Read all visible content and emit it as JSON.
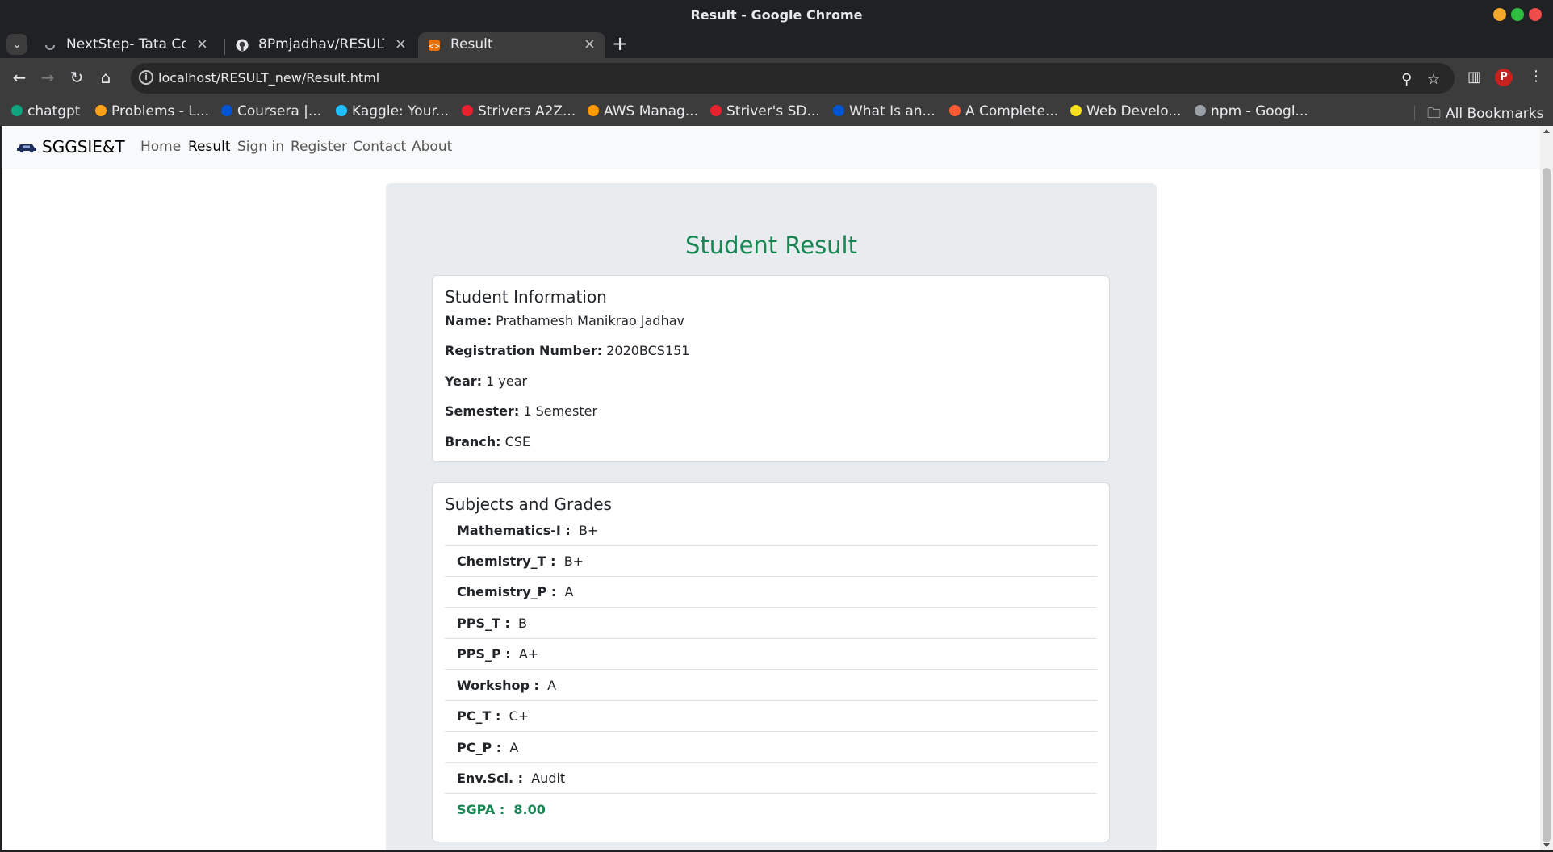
{
  "window": {
    "title": "Result - Google Chrome"
  },
  "tabs": [
    {
      "label": "NextStep- Tata Consu",
      "icon": "loading-spinner-icon"
    },
    {
      "label": "8Pmjadhav/RESULT: r",
      "icon": "github-icon"
    },
    {
      "label": "Result",
      "icon": "html-file-icon",
      "active": true
    }
  ],
  "omnibox": {
    "url": "localhost/RESULT_new/Result.html"
  },
  "profile": {
    "initial": "P"
  },
  "bookmarks": [
    {
      "label": "chatgpt",
      "color": "#10a37f"
    },
    {
      "label": "Problems - L...",
      "color": "#ffa116"
    },
    {
      "label": "Coursera |...",
      "color": "#0056d2"
    },
    {
      "label": "Kaggle: Your...",
      "color": "#20beff"
    },
    {
      "label": "Strivers A2Z...",
      "color": "#e8212f"
    },
    {
      "label": "AWS Manag...",
      "color": "#ff9900"
    },
    {
      "label": "Striver's SD...",
      "color": "#e8212f"
    },
    {
      "label": "What Is an...",
      "color": "#0056d2"
    },
    {
      "label": "A Complete...",
      "color": "#ff5a36"
    },
    {
      "label": "Web Develo...",
      "color": "#f7df1e"
    },
    {
      "label": "npm - Googl...",
      "color": "#9aa0a6"
    }
  ],
  "all_bookmarks": "All Bookmarks",
  "site": {
    "brand": "SGGSIE&T",
    "nav": [
      "Home",
      "Result",
      "Sign in",
      "Register",
      "Contact",
      "About"
    ],
    "active_nav": "Result"
  },
  "result": {
    "heading": "Student Result",
    "info_title": "Student Information",
    "info": [
      {
        "label": "Name:",
        "value": "Prathamesh Manikrao Jadhav"
      },
      {
        "label": "Registration Number:",
        "value": "2020BCS151"
      },
      {
        "label": "Year:",
        "value": "1 year"
      },
      {
        "label": "Semester:",
        "value": "1 Semester"
      },
      {
        "label": "Branch:",
        "value": "CSE"
      }
    ],
    "grades_title": "Subjects and Grades",
    "grades": [
      {
        "subject": "Mathematics-I :",
        "grade": "B+"
      },
      {
        "subject": "Chemistry_T :",
        "grade": "B+"
      },
      {
        "subject": "Chemistry_P :",
        "grade": "A"
      },
      {
        "subject": "PPS_T :",
        "grade": "B"
      },
      {
        "subject": "PPS_P :",
        "grade": "A+"
      },
      {
        "subject": "Workshop :",
        "grade": "A"
      },
      {
        "subject": "PC_T :",
        "grade": "C+"
      },
      {
        "subject": "PC_P :",
        "grade": "A"
      },
      {
        "subject": "Env.Sci. :",
        "grade": "Audit"
      }
    ],
    "sgpa": {
      "label": "SGPA :",
      "value": "8.00"
    }
  }
}
